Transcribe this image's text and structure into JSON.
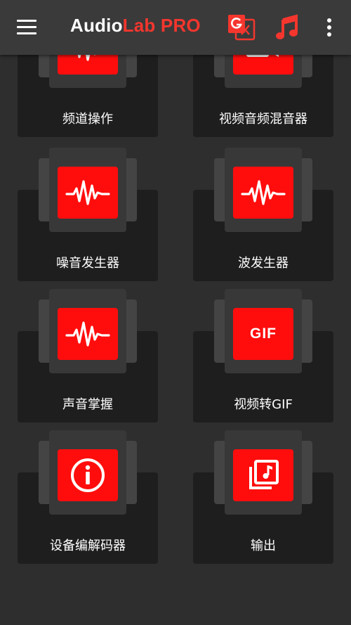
{
  "app": {
    "title_part1": "Audio",
    "title_part2": "Lab PRO"
  },
  "toolbar": {
    "menu_icon": "hamburger-menu-icon",
    "translate_icon": "google-translate-icon",
    "music_icon": "music-note-icon",
    "more_icon": "more-vertical-icon"
  },
  "colors": {
    "accent": "#f4362e",
    "icon_bg": "#ff0d0d",
    "appbar_bg": "#3a3a3a",
    "page_bg": "#2e2e2e"
  },
  "tiles": [
    {
      "label": "频道操作",
      "icon": "waveform-icon"
    },
    {
      "label": "视频音频混音器",
      "icon": "video-icon"
    },
    {
      "label": "噪音发生器",
      "icon": "waveform-icon"
    },
    {
      "label": "波发生器",
      "icon": "waveform-icon"
    },
    {
      "label": "声音掌握",
      "icon": "waveform-icon"
    },
    {
      "label": "视频转GIF",
      "icon": "gif-icon",
      "icon_text": "GIF"
    },
    {
      "label": "设备编解码器",
      "icon": "info-icon",
      "icon_text": "i"
    },
    {
      "label": "输出",
      "icon": "music-library-icon"
    }
  ]
}
